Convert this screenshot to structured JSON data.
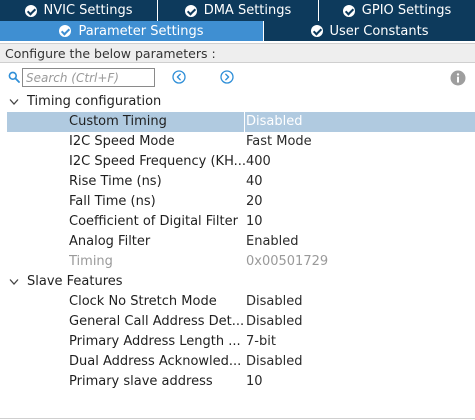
{
  "tabs_top": [
    {
      "label": "NVIC Settings",
      "active": false
    },
    {
      "label": "DMA Settings",
      "active": false
    },
    {
      "label": "GPIO Settings",
      "active": false
    }
  ],
  "tabs_second": [
    {
      "label": "Parameter Settings",
      "active": true
    },
    {
      "label": "User Constants",
      "active": false
    }
  ],
  "configure_label": "Configure the below parameters :",
  "search": {
    "placeholder": "Search (Ctrl+F)",
    "value": ""
  },
  "groups": [
    {
      "label": "Timing configuration",
      "rows": [
        {
          "name": "Custom Timing",
          "value": "Disabled"
        },
        {
          "name": "I2C Speed Mode",
          "value": "Fast Mode"
        },
        {
          "name": "I2C Speed Frequency (KH...",
          "value": "400"
        },
        {
          "name": "Rise Time (ns)",
          "value": "40"
        },
        {
          "name": "Fall Time (ns)",
          "value": "20"
        },
        {
          "name": "Coefficient of Digital Filter",
          "value": "10"
        },
        {
          "name": "Analog Filter",
          "value": "Enabled"
        },
        {
          "name": "Timing",
          "value": "0x00501729"
        }
      ]
    },
    {
      "label": "Slave Features",
      "rows": [
        {
          "name": "Clock No Stretch Mode",
          "value": "Disabled"
        },
        {
          "name": "General Call Address Det...",
          "value": "Disabled"
        },
        {
          "name": "Primary Address Length ...",
          "value": "7-bit"
        },
        {
          "name": "Dual Address Acknowled...",
          "value": "Disabled"
        },
        {
          "name": "Primary slave address",
          "value": "10"
        }
      ]
    }
  ],
  "colors": {
    "tab_dark": "#0d3a5c",
    "tab_active": "#3f8fd2",
    "selected_row": "#b0cae0",
    "accent_blue": "#2f8fd8"
  }
}
